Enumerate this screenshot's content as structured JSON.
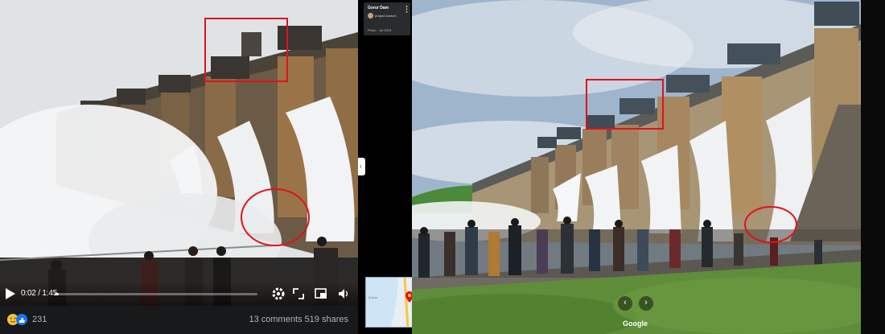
{
  "video": {
    "time_display": "0:02 / 1:45",
    "progress": 0.02,
    "reaction_count": "231",
    "comments_shares": "13 comments  519 shares"
  },
  "place_card": {
    "title": "Gorur Dam",
    "user": "prajwal kashoh",
    "date": "Photo - Jul 2018"
  },
  "minimap": {
    "label": "N Arm"
  },
  "street_view": {
    "logo": "Google",
    "prev_arrow": "‹",
    "next_arrow": "›"
  },
  "icons": [
    "play-icon",
    "settings-icon",
    "expand-icon",
    "picture-in-picture-icon",
    "volume-icon",
    "reaction-icons",
    "more-vert-icon",
    "pin-icon"
  ],
  "colors": {
    "highlight": "#e0121c",
    "accent": "#1877f2"
  }
}
